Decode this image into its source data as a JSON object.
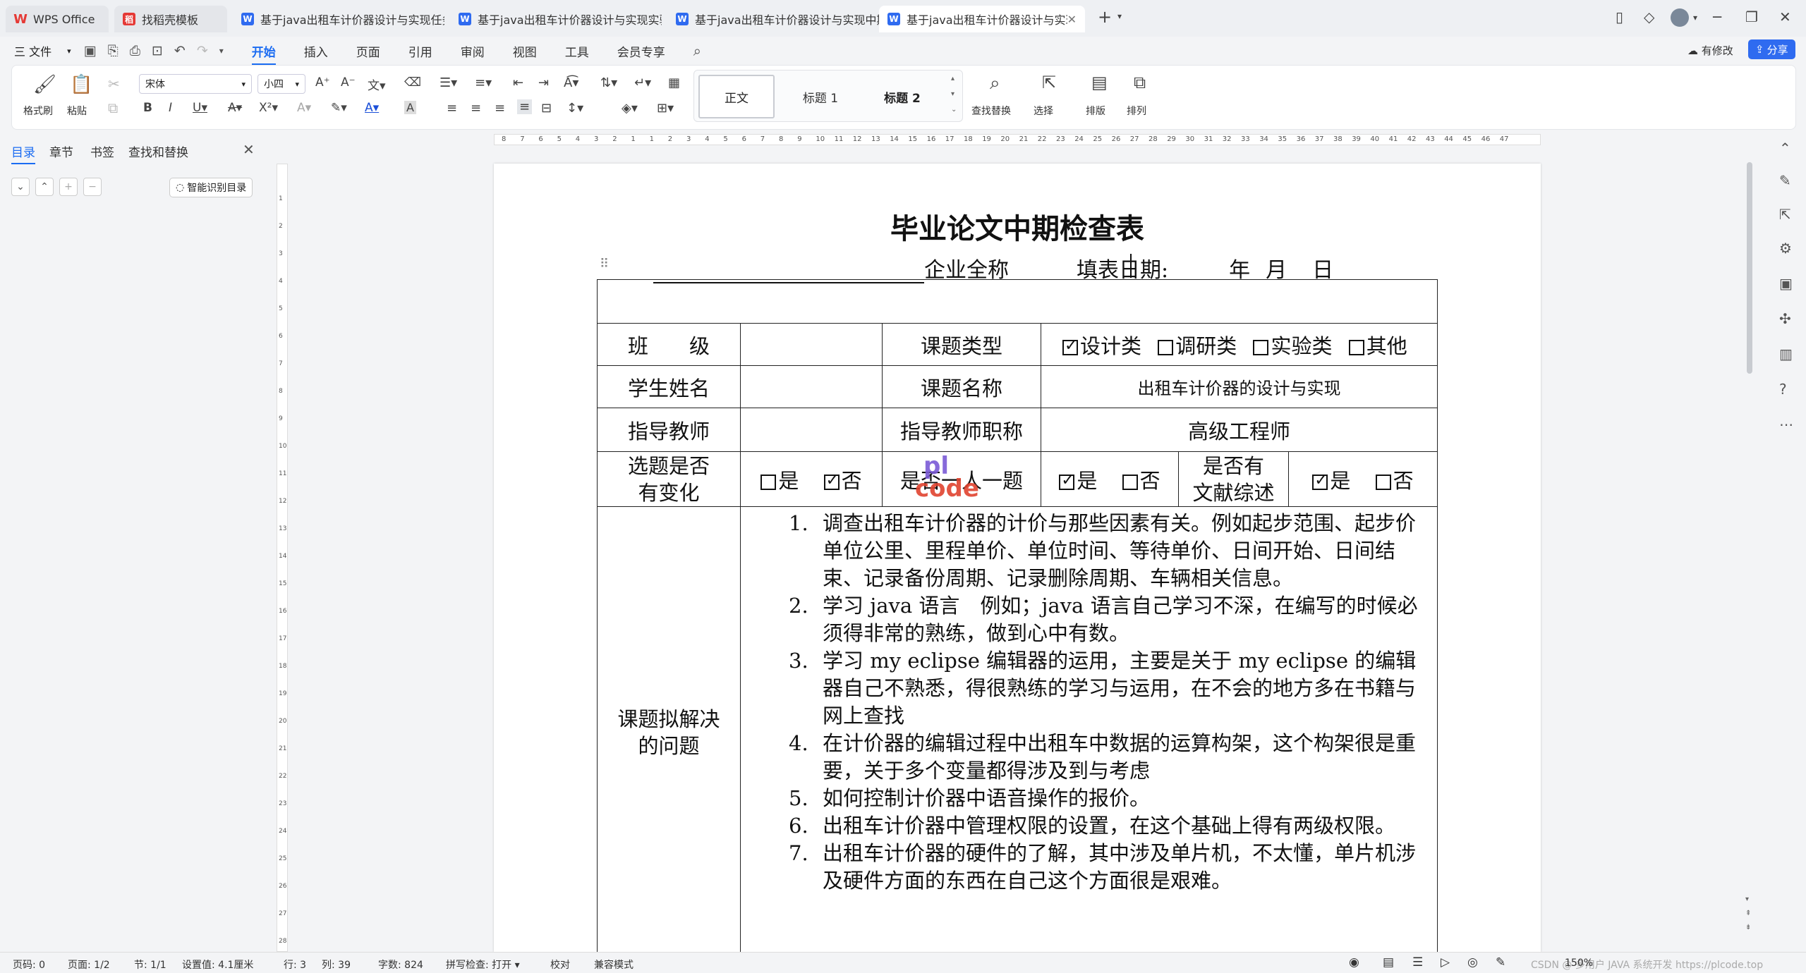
{
  "tabs": [
    {
      "label": "WPS Office",
      "icon": "wps-logo-icon",
      "color": "#e53935"
    },
    {
      "label": "找稻壳模板",
      "icon": "docer-icon",
      "color": "#e53935"
    },
    {
      "label": "基于java出租车计价器设计与实现任务",
      "icon": "word-doc-icon",
      "color": "#2f6bf0"
    },
    {
      "label": "基于java出租车计价器设计与实现实验",
      "icon": "word-doc-icon",
      "color": "#2f6bf0"
    },
    {
      "label": "基于java出租车计价器设计与实现中期",
      "icon": "word-doc-icon",
      "color": "#2f6bf0"
    },
    {
      "label": "基于java出租车计价器设计与实现",
      "icon": "word-doc-icon",
      "color": "#2f6bf0"
    }
  ],
  "menubar": {
    "file": "三 文件",
    "items": [
      "开始",
      "插入",
      "页面",
      "引用",
      "审阅",
      "视图",
      "工具",
      "会员专享"
    ],
    "active": "开始",
    "revise": "有修改",
    "share": "分享"
  },
  "ribbon": {
    "format_painter": "格式刷",
    "paste": "粘贴",
    "font_name": "宋体",
    "font_size": "小四",
    "styles": [
      "正文",
      "标题 1",
      "标题 2"
    ],
    "find_replace": "查找替换",
    "select": "选择",
    "layout": "排版",
    "arrange": "排列"
  },
  "nav": {
    "tabs": [
      "目录",
      "章节",
      "书签",
      "查找和替换"
    ],
    "active": "目录",
    "smart_toc": "智能识别目录"
  },
  "ruler": {
    "h_labels": [
      "8",
      "7",
      "6",
      "5",
      "4",
      "3",
      "2",
      "1",
      "1",
      "2",
      "3",
      "4",
      "5",
      "6",
      "7",
      "8",
      "9",
      "10",
      "11",
      "12",
      "13",
      "14",
      "15",
      "16",
      "17",
      "18",
      "19",
      "20",
      "21",
      "22",
      "23",
      "24",
      "25",
      "26",
      "27",
      "28",
      "29",
      "30",
      "31",
      "32",
      "33",
      "34",
      "35",
      "36",
      "37",
      "38",
      "39",
      "40",
      "41",
      "42",
      "43",
      "44",
      "45",
      "46",
      "47"
    ],
    "v_labels": [
      "1",
      "2",
      "3",
      "4",
      "5",
      "6",
      "7",
      "8",
      "9",
      "10",
      "11",
      "12",
      "13",
      "14",
      "15",
      "16",
      "17",
      "18",
      "19",
      "20",
      "21",
      "22",
      "23",
      "24",
      "25",
      "26",
      "27",
      "28"
    ]
  },
  "document": {
    "title": "毕业论文中期检查表",
    "company_label": "企业全称",
    "fill_date_label": "填表日期:",
    "year": "年",
    "month": "月",
    "day": "日",
    "rows": {
      "class_label": "班　　级",
      "topic_type_label": "课题类型",
      "types": [
        {
          "label": "设计类",
          "checked": true
        },
        {
          "label": "调研类",
          "checked": false
        },
        {
          "label": "实验类",
          "checked": false
        },
        {
          "label": "其他",
          "checked": false
        }
      ],
      "student_label": "学生姓名",
      "topic_name_label": "课题名称",
      "topic_name": "出租车计价器的设计与实现",
      "advisor_label": "指导教师",
      "advisor_title_label": "指导教师职称",
      "advisor_title": "高级工程师",
      "changed_label_1": "选题是否",
      "changed_label_2": "有变化",
      "yes": "是",
      "no": "否",
      "one_person_label": "是否一人一题",
      "lit_label_1": "是否有",
      "lit_label_2": "文献综述",
      "issues_label_1": "课题拟解决",
      "issues_label_2": "的问题"
    },
    "issues": [
      "调查出租车计价器的计价与那些因素有关。例如起步范围、起步价单位公里、里程单价、单位时间、等待单价、日间开始、日间结束、记录备份周期、记录删除周期、车辆相关信息。",
      "学习 java 语言　例如；java 语言自己学习不深，在编写的时候必须得非常的熟练，做到心中有数。",
      "学习 my eclipse 编辑器的运用，主要是关于 my eclipse 的编辑器自己不熟悉，得很熟练的学习与运用，在不会的地方多在书籍与网上查找",
      "在计价器的编辑过程中出租车中数据的运算构架，这个构架很是重要，关于多个变量都得涉及到与考虑",
      "如何控制计价器中语音操作的报价。",
      "出租车计价器中管理权限的设置，在这个基础上得有两级权限。",
      "出租车计价器的硬件的了解，其中涉及单片机，不太懂，单片机涉及硬件方面的东西在自己这个方面很是艰难。"
    ],
    "watermark_top": "pl",
    "watermark_bottom": "code"
  },
  "status": {
    "page_no": "页码: 0",
    "page": "页面: 1/2",
    "section": "节: 1/1",
    "setting": "设置值: 4.1厘米",
    "row": "行: 3",
    "col": "列: 39",
    "words": "字数: 824",
    "spell": "拼写检查: 打开",
    "proof": "校对",
    "compat": "兼容模式",
    "zoom": "150%",
    "watermark": "CSDN @ 多用户 JAVA 系统开发 https://plcode.top"
  }
}
